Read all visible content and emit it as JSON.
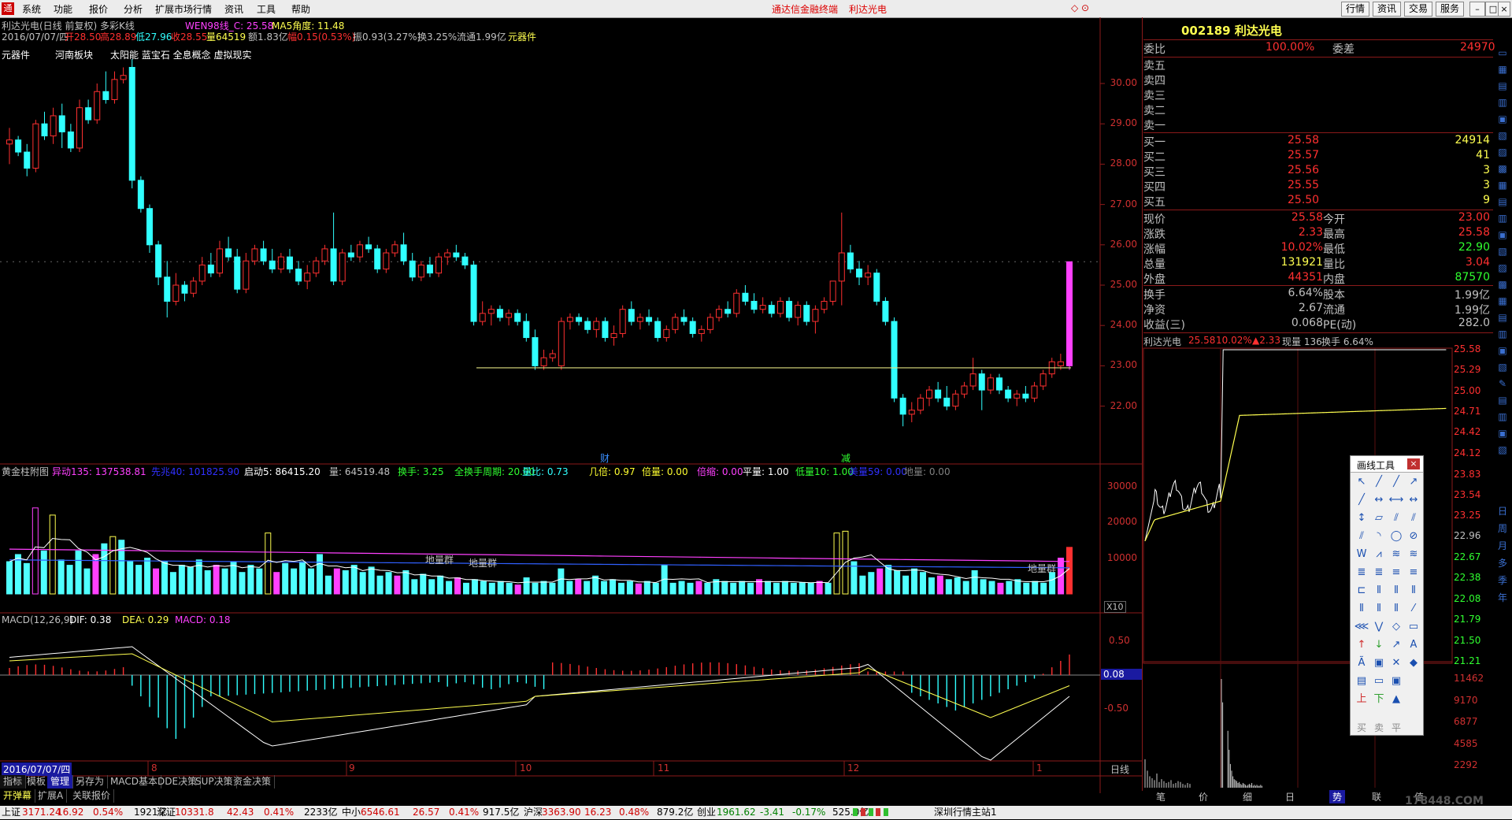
{
  "menu": {
    "items": [
      "系统",
      "功能",
      "报价",
      "分析",
      "扩展市场行情",
      "资讯",
      "工具",
      "帮助"
    ],
    "center_title": "通达信金融终端",
    "center_stock": "利达光电",
    "right_buttons": [
      "行情",
      "资讯",
      "交易",
      "服务"
    ]
  },
  "chart_header": {
    "line1": "利达光电(日线 前复权) 多彩K线",
    "indicator": "WEN98线_C: 25.58",
    "ma5": "MA5角度: 11.48",
    "line2_date": "2016/07/07/四",
    "open": "开28.50",
    "high": "高28.89",
    "low": "低27.96",
    "close": "收28.55",
    "volume": "量64519",
    "amount": "额1.83亿",
    "change": "幅0.15(0.53%)",
    "amplitude": "振0.93(3.27%)",
    "turnover": "换3.25%",
    "float": "流通1.99亿",
    "tag": "元器件"
  },
  "concept_tags": [
    "元器件",
    "河南板块",
    "太阳能 蓝宝石 全息概念 虚拟现实"
  ],
  "price_axis": [
    "30.00",
    "29.00",
    "28.00",
    "27.00",
    "26.00",
    "25.00",
    "24.00",
    "23.00",
    "22.00"
  ],
  "event_marks": [
    "财",
    "减"
  ],
  "volume_panel": {
    "title": "黄金柱附图",
    "fields": [
      {
        "label": "异动135: 137538.81",
        "color": "#ff40ff"
      },
      {
        "label": "先兆40: 101825.90",
        "color": "#3030ff"
      },
      {
        "label": "启动5: 86415.20",
        "color": "#ffffff"
      },
      {
        "label": "量: 64519.48",
        "color": "#c0c0c0"
      },
      {
        "label": "换手: 3.25",
        "color": "#30ff30"
      },
      {
        "label": "全换手周期: 20.00",
        "color": "#30ff30"
      },
      {
        "label": "量比: 0.73",
        "color": "#30ffff"
      },
      {
        "label": "几倍: 0.97",
        "color": "#ffff30"
      },
      {
        "label": "倍量: 0.00",
        "color": "#ffff30"
      },
      {
        "label": "倍缩: 0.00",
        "color": "#ff40ff"
      },
      {
        "label": "平量: 1.00",
        "color": "#ffffff"
      },
      {
        "label": "低量10: 1.00",
        "color": "#30ff30"
      },
      {
        "label": "美量59: 0.00",
        "color": "#3030ff"
      },
      {
        "label": "地量: 0.00",
        "color": "#808080"
      }
    ],
    "axis": [
      "30000",
      "20000",
      "10000"
    ],
    "unit": "X10",
    "annotations": [
      "地量群",
      "地量群",
      "地量群"
    ]
  },
  "macd_panel": {
    "title": "MACD(12,26,9)",
    "dif": "DIF: 0.38",
    "dea": "DEA: 0.29",
    "macd": "MACD: 0.18",
    "axis": [
      "0.50",
      "-0.50"
    ],
    "current": "0.08"
  },
  "date_axis": {
    "start": "2016/07/07/四",
    "months": [
      "8",
      "9",
      "10",
      "11",
      "12",
      "1"
    ],
    "period": "日线"
  },
  "bottom_tabs": [
    "指标",
    "模板",
    "管理",
    "另存为",
    "MACD基本",
    "DDE决策",
    "SUP决策",
    "资金决策"
  ],
  "bottom_tabs2": [
    "开弹幕",
    "扩展A",
    "关联报价"
  ],
  "quote": {
    "code_name": "002189 利达光电",
    "weibi_label": "委比",
    "weibi": "100.00%",
    "weicha_label": "委差",
    "weicha": "24970",
    "sells": [
      "卖五",
      "卖四",
      "卖三",
      "卖二",
      "卖一"
    ],
    "buys": [
      {
        "label": "买一",
        "price": "25.58",
        "vol": "24914"
      },
      {
        "label": "买二",
        "price": "25.57",
        "vol": "41"
      },
      {
        "label": "买三",
        "price": "25.56",
        "vol": "3"
      },
      {
        "label": "买四",
        "price": "25.55",
        "vol": "3"
      },
      {
        "label": "买五",
        "price": "25.50",
        "vol": "9"
      }
    ],
    "stats": [
      {
        "l1": "现价",
        "v1": "25.58",
        "l2": "今开",
        "v2": "23.00"
      },
      {
        "l1": "涨跌",
        "v1": "2.33",
        "l2": "最高",
        "v2": "25.58"
      },
      {
        "l1": "涨幅",
        "v1": "10.02%",
        "l2": "最低",
        "v2": "22.90"
      },
      {
        "l1": "总量",
        "v1": "131921",
        "l2": "量比",
        "v2": "3.04"
      },
      {
        "l1": "外盘",
        "v1": "44351",
        "l2": "内盘",
        "v2": "87570"
      }
    ],
    "stats2": [
      {
        "l1": "换手",
        "v1": "6.64%",
        "l2": "股本",
        "v2": "1.99亿"
      },
      {
        "l1": "净资",
        "v1": "2.67",
        "l2": "流通",
        "v2": "1.99亿"
      },
      {
        "l1": "收益(三)",
        "v1": "0.068",
        "l2": "PE(动)",
        "v2": "282.0"
      }
    ]
  },
  "mini": {
    "title": "利达光电",
    "price": "25.58",
    "pct": "10.02%",
    "chg": "▲2.33",
    "vol": "现量 136",
    "turn": "换手 6.64%",
    "axis": [
      "25.58",
      "25.29",
      "25.00",
      "24.71",
      "24.42",
      "24.12",
      "23.83",
      "23.54",
      "23.25",
      "22.96",
      "22.67",
      "22.38",
      "22.08",
      "21.79",
      "21.50",
      "21.21"
    ],
    "vol_axis": [
      "11462",
      "9170",
      "6877",
      "4585",
      "2292"
    ],
    "tabs": [
      "笔",
      "价",
      "细",
      "日",
      "势",
      "联",
      "值"
    ]
  },
  "draw_tools": {
    "title": "画线工具",
    "close": "×",
    "bottom": [
      "买",
      "卖",
      "平"
    ]
  },
  "side_buttons": [
    "日",
    "周",
    "月",
    "多",
    "季",
    "年"
  ],
  "status": {
    "items": [
      {
        "name": "上证",
        "val": "3171.24",
        "chg": "16.92",
        "pct": "0.54%",
        "amt": "1921亿"
      },
      {
        "name": "深证",
        "val": "10331.8",
        "chg": "42.43",
        "pct": "0.41%",
        "amt": "2233亿"
      },
      {
        "name": "中小",
        "val": "6546.61",
        "chg": "26.57",
        "pct": "0.41%",
        "amt": "917.5亿"
      },
      {
        "name": "沪深",
        "val": "3363.90",
        "chg": "16.23",
        "pct": "0.48%",
        "amt": "879.2亿"
      },
      {
        "name": "创业",
        "val": "1961.62",
        "chg": "-3.41",
        "pct": "-0.17%",
        "amt": "525.0亿"
      }
    ],
    "site": "深圳行情主站1",
    "watermark": "178448.COM"
  },
  "colors": {
    "up": "#ff3030",
    "down": "#30ffff",
    "yellow": "#ffff50",
    "magenta": "#ff40ff"
  }
}
